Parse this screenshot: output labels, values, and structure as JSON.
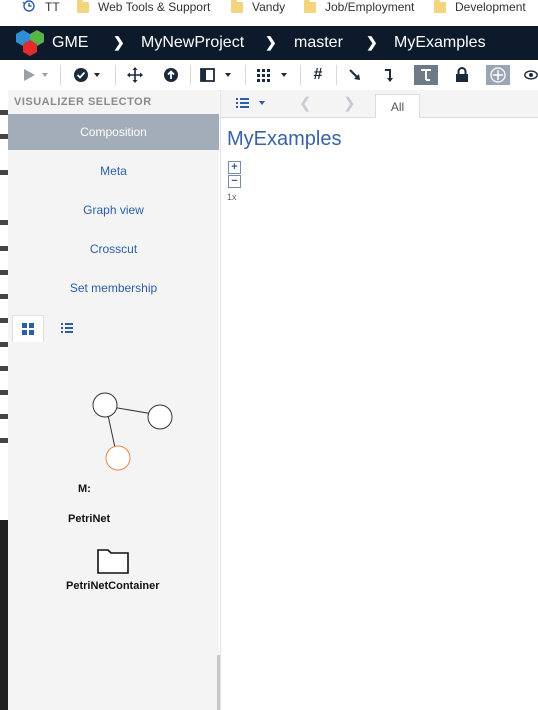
{
  "bookmarks": {
    "items": [
      {
        "label": "TT",
        "icon": "history-icon"
      },
      {
        "label": "Web Tools & Support",
        "icon": "folder-icon"
      },
      {
        "label": "Vandy",
        "icon": "folder-icon"
      },
      {
        "label": "Job/Employment",
        "icon": "folder-icon"
      },
      {
        "label": "Development",
        "icon": "folder-icon"
      }
    ]
  },
  "header": {
    "app_name": "GME",
    "breadcrumbs": [
      "MyNewProject",
      "master",
      "MyExamples"
    ],
    "colors": {
      "bg": "#0c1a2c",
      "logo_blue": "#2e8fd6",
      "logo_green": "#57b34a",
      "logo_red": "#e12c2c"
    }
  },
  "toolbar": {
    "items": [
      "play-icon",
      "check-circle-icon",
      "move-icon",
      "up-arrow-circle-icon",
      "panel-layout-icon",
      "grid-icon",
      "hash-icon",
      "pointer-icon",
      "connect-icon",
      "hierarchy-icon",
      "lock-icon",
      "pan-icon",
      "eye-icon"
    ]
  },
  "sidebar": {
    "title": "VISUALIZER SELECTOR",
    "visualizers": [
      {
        "label": "Composition",
        "active": true
      },
      {
        "label": "Meta",
        "active": false
      },
      {
        "label": "Graph view",
        "active": false
      },
      {
        "label": "Crosscut",
        "active": false
      },
      {
        "label": "Set membership",
        "active": false
      }
    ],
    "view_tabs": [
      "grid-view-icon",
      "list-view-icon"
    ],
    "palette": {
      "meta_label": "M:",
      "items": [
        {
          "label": "PetriNet",
          "icon": "petrinet-graph-icon"
        },
        {
          "label": "PetriNetContainer",
          "icon": "folder-icon"
        }
      ]
    }
  },
  "editor": {
    "tab_label": "All",
    "title": "MyExamples",
    "zoom_in": "+",
    "zoom_out": "−",
    "zoom_level": "1x"
  }
}
